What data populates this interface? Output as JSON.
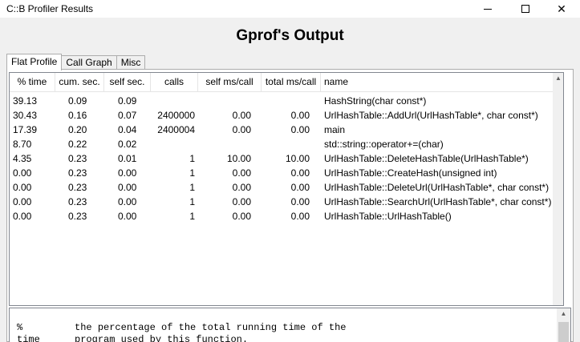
{
  "window": {
    "title": "C::B Profiler Results"
  },
  "heading": "Gprof's Output",
  "tabs": [
    {
      "label": "Flat Profile",
      "active": true
    },
    {
      "label": "Call Graph",
      "active": false
    },
    {
      "label": "Misc",
      "active": false
    }
  ],
  "table": {
    "columns": [
      "% time",
      "cum. sec.",
      "self sec.",
      "calls",
      "self ms/call",
      "total ms/call",
      "name"
    ],
    "rows": [
      [
        "39.13",
        "0.09",
        "0.09",
        "",
        "",
        "",
        "HashString(char const*)"
      ],
      [
        "30.43",
        "0.16",
        "0.07",
        "2400000",
        "0.00",
        "0.00",
        "UrlHashTable::AddUrl(UrlHashTable*, char const*)"
      ],
      [
        "17.39",
        "0.20",
        "0.04",
        "2400004",
        "0.00",
        "0.00",
        "main"
      ],
      [
        "8.70",
        "0.22",
        "0.02",
        "",
        "",
        "",
        "std::string::operator+=(char)"
      ],
      [
        "4.35",
        "0.23",
        "0.01",
        "1",
        "10.00",
        "10.00",
        "UrlHashTable::DeleteHashTable(UrlHashTable*)"
      ],
      [
        "0.00",
        "0.23",
        "0.00",
        "1",
        "0.00",
        "0.00",
        "UrlHashTable::CreateHash(unsigned int)"
      ],
      [
        "0.00",
        "0.23",
        "0.00",
        "1",
        "0.00",
        "0.00",
        "UrlHashTable::DeleteUrl(UrlHashTable*, char const*)"
      ],
      [
        "0.00",
        "0.23",
        "0.00",
        "1",
        "0.00",
        "0.00",
        "UrlHashTable::SearchUrl(UrlHashTable*, char const*)"
      ],
      [
        "0.00",
        "0.23",
        "0.00",
        "1",
        "0.00",
        "0.00",
        "UrlHashTable::UrlHashTable()"
      ]
    ]
  },
  "description": {
    "line1": "%         the percentage of the total running time of the",
    "line2": "time      program used by this function."
  },
  "icons": {
    "minimize": "minimize-icon",
    "maximize": "maximize-icon",
    "close": "close-icon"
  }
}
